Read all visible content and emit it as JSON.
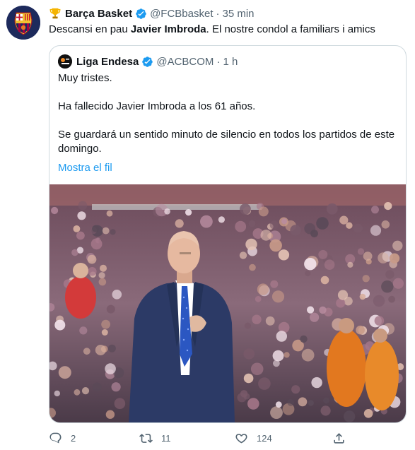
{
  "tweet": {
    "display_name": "Barça Basket",
    "handle": "@FCBbasket",
    "separator": "·",
    "time": "35 min",
    "text_prefix": "Descansi en pau ",
    "text_bold": "Javier Imbroda",
    "text_suffix": ". El nostre condol a familiars i amics",
    "avatar_icon": "fcb-crest-icon",
    "badge_icon": "trophy-icon",
    "verified_icon": "verified-badge-icon"
  },
  "quote": {
    "display_name": "Liga Endesa",
    "handle": "@ACBCOM",
    "separator": "·",
    "time": "1 h",
    "lines": [
      "Muy tristes.",
      "Ha fallecido Javier Imbroda a los 61 años.",
      "Se guardará un sentido minuto de silencio en todos los partidos de este domingo."
    ],
    "show_thread": "Mostra el fil"
  },
  "actions": {
    "reply_count": "2",
    "retweet_count": "11",
    "like_count": "124"
  },
  "colors": {
    "accent": "#1d9bf0",
    "secondary_text": "#536471",
    "border": "#cfd9de"
  }
}
